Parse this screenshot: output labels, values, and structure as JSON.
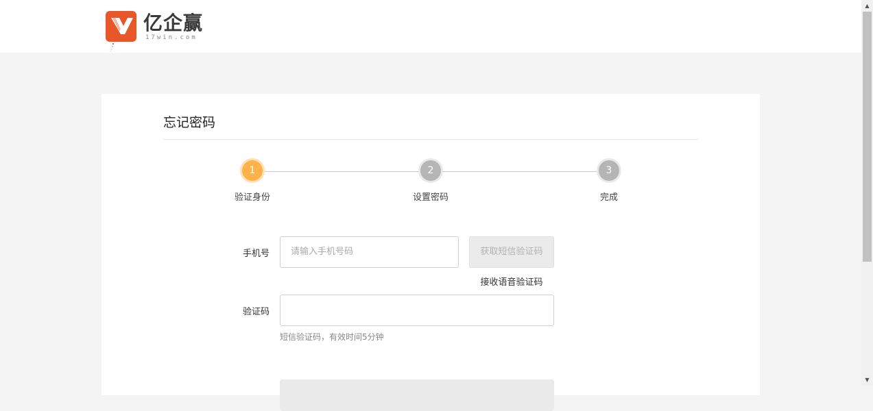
{
  "header": {
    "logo_name": "亿企赢",
    "logo_sub": "17win.com"
  },
  "page": {
    "title": "忘记密码"
  },
  "steps": [
    {
      "number": "1",
      "label": "验证身份",
      "state": "active"
    },
    {
      "number": "2",
      "label": "设置密码",
      "state": "inactive"
    },
    {
      "number": "3",
      "label": "完成",
      "state": "inactive"
    }
  ],
  "form": {
    "phone_label": "手机号",
    "phone_placeholder": "请输入手机号码",
    "sms_button": "获取短信验证码",
    "voice_link": "接收语音验证码",
    "code_label": "验证码",
    "code_value": "",
    "hint": "短信验证码，有效时间5分钟"
  },
  "colors": {
    "brand": "#e8572a",
    "step_active": "#ffb14a",
    "step_inactive": "#b5b5b5"
  }
}
